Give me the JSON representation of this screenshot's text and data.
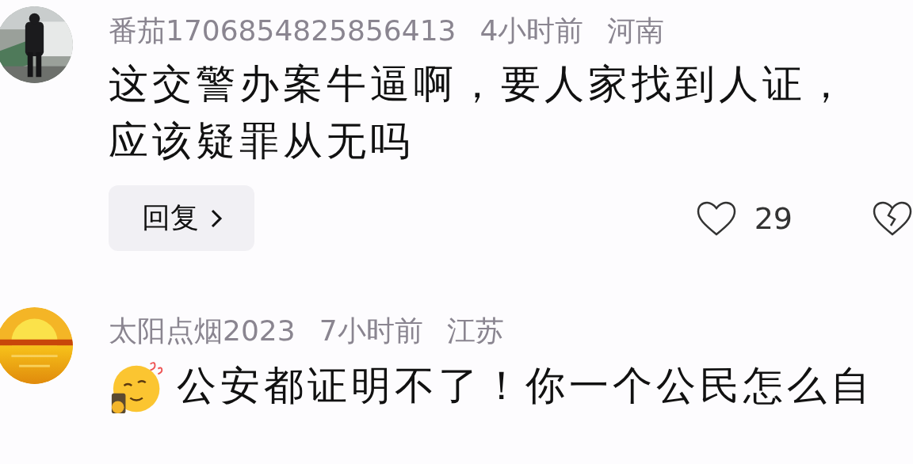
{
  "comments": [
    {
      "username": "番茄1706854825856413",
      "time": "4小时前",
      "location": "河南",
      "body": [
        {
          "kind": "text",
          "lines": [
            "这交警办案牛逼啊，要人家找到人证，",
            "应该疑罪从无吗"
          ]
        }
      ],
      "reply_button": {
        "label": "回复"
      },
      "likes": "29"
    },
    {
      "username": "太阳点烟2023",
      "time": "7小时前",
      "location": "江苏",
      "body": [
        {
          "kind": "emoji"
        },
        {
          "kind": "text",
          "lines": [
            "公安都证明不了！你一个公民怎么自"
          ]
        }
      ]
    }
  ]
}
